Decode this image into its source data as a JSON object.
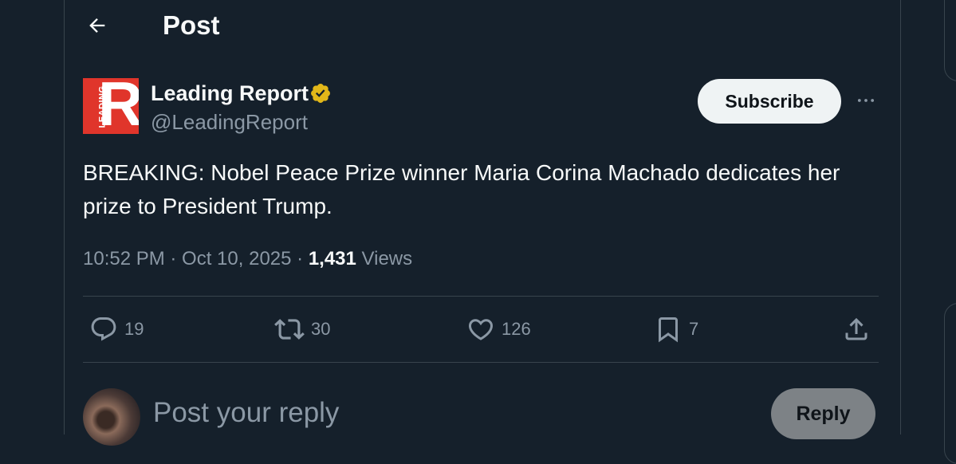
{
  "header": {
    "title": "Post"
  },
  "author": {
    "name": "Leading Report",
    "handle": "@LeadingReport",
    "avatar_letter": "R",
    "avatar_small_text": "LEADING",
    "verified_color": "#e2b719"
  },
  "subscribe_label": "Subscribe",
  "tweet": {
    "text": "BREAKING: Nobel Peace Prize winner Maria Corina Machado dedicates her prize to President Trump.",
    "time": "10:52 PM · Oct 10, 2025 · ",
    "views_count": "1,431",
    "views_label": " Views"
  },
  "actions": {
    "replies": "19",
    "reposts": "30",
    "likes": "126",
    "bookmarks": "7"
  },
  "reply": {
    "placeholder": "Post your reply",
    "button_label": "Reply"
  },
  "colors": {
    "background": "#15202b",
    "border": "#38444d",
    "muted": "#8b98a5",
    "brand_red": "#e0352b"
  }
}
